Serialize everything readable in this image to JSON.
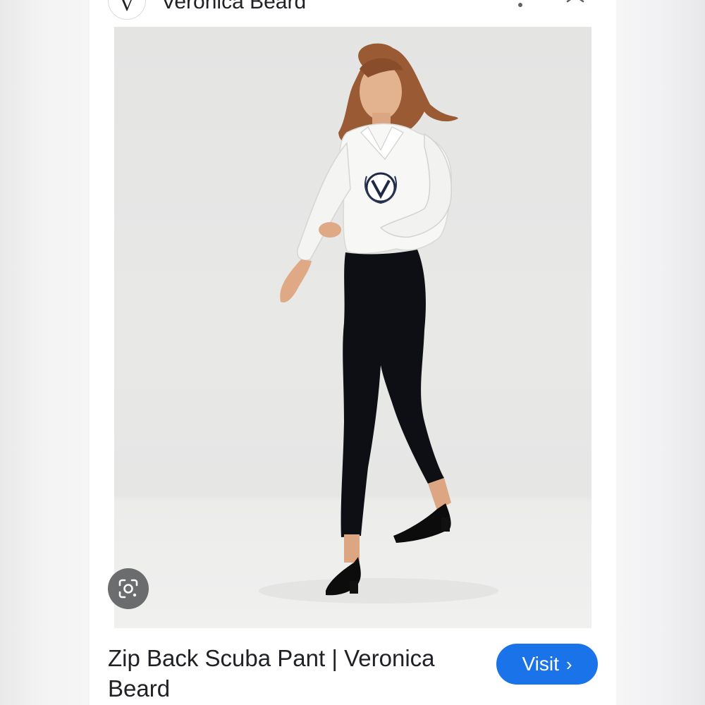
{
  "header": {
    "site_name": "Veronica Beard",
    "site_logo_letter": "V",
    "more_icon": "more-vert-icon",
    "close_icon": "close-icon"
  },
  "image": {
    "lens_icon": "google-lens-icon"
  },
  "result": {
    "title": "Zip Back Scuba Pant | Veronica Beard",
    "visit_label": "Visit",
    "visit_chevron": "›"
  },
  "colors": {
    "visit_button": "#1a73e8",
    "text": "#202124",
    "lens_button": "#5f6163"
  }
}
